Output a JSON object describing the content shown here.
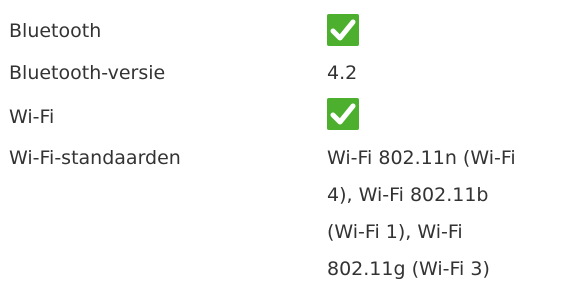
{
  "specs": {
    "rows": [
      {
        "label": "Bluetooth",
        "value_icon": "check-icon",
        "value_supported": true
      },
      {
        "label": "Bluetooth-versie",
        "value": "4.2"
      },
      {
        "label": "Wi-Fi",
        "value_icon": "check-icon",
        "value_supported": true
      },
      {
        "label": "Wi-Fi-standaarden",
        "value_lines": [
          "Wi-Fi 802.11n (Wi-Fi",
          "4), Wi-Fi 802.11b",
          "(Wi-Fi 1), Wi-Fi",
          "802.11g (Wi-Fi 3)"
        ]
      }
    ]
  },
  "colors": {
    "check_background": "#4caf2e",
    "check_mark": "#ffffff",
    "text": "#333333"
  }
}
